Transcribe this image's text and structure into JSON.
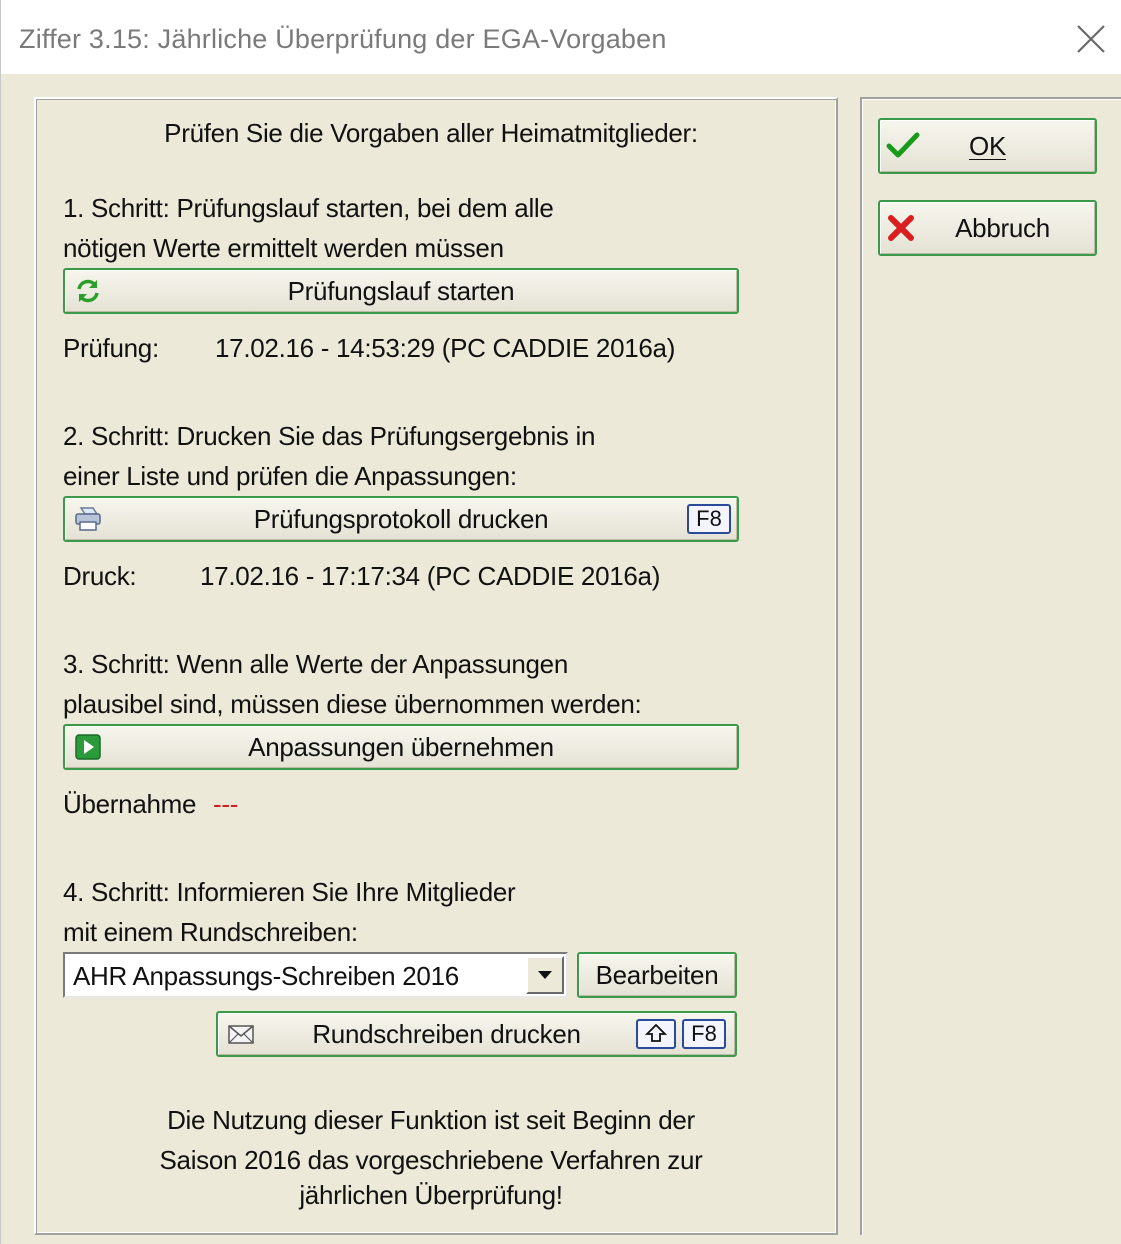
{
  "window": {
    "title": "Ziffer 3.15: Jährliche Überprüfung der EGA-Vorgaben"
  },
  "intro": "Prüfen Sie die Vorgaben aller Heimatmitglieder:",
  "step1": {
    "line1": "1. Schritt: Prüfungslauf starten, bei dem alle",
    "line2": "nötigen Werte ermittelt werden müssen",
    "button": "Prüfungslauf starten",
    "status_label": "Prüfung:",
    "status_value": "17.02.16 - 14:53:29 (PC CADDIE 2016a)"
  },
  "step2": {
    "line1": "2. Schritt: Drucken Sie das Prüfungsergebnis in",
    "line2": "einer Liste und prüfen die Anpassungen:",
    "button": "Prüfungsprotokoll drucken",
    "shortcut": "F8",
    "status_label": "Druck:",
    "status_value": "17.02.16 - 17:17:34 (PC CADDIE 2016a)"
  },
  "step3": {
    "line1": "3. Schritt: Wenn alle Werte der Anpassungen",
    "line2": "plausibel sind, müssen diese übernommen werden:",
    "button": "Anpassungen übernehmen",
    "status_label": "Übernahme",
    "status_value": "---"
  },
  "step4": {
    "line1": "4. Schritt: Informieren Sie Ihre Mitglieder",
    "line2": "mit einem Rundschreiben:",
    "dropdown_value": "AHR Anpassungs-Schreiben 2016",
    "edit_button": "Bearbeiten",
    "print_button": "Rundschreiben drucken",
    "shortcut": "F8"
  },
  "footer": {
    "line1": "Die Nutzung dieser Funktion ist seit Beginn der",
    "line2": "Saison 2016 das vorgeschriebene Verfahren zur",
    "line3": "jährlichen Überprüfung!"
  },
  "actions": {
    "ok": "OK",
    "cancel": "Abbruch"
  },
  "colors": {
    "button_border": "#3a9a4a",
    "key_border": "#2a4a9a",
    "status_empty": "#d02020"
  }
}
